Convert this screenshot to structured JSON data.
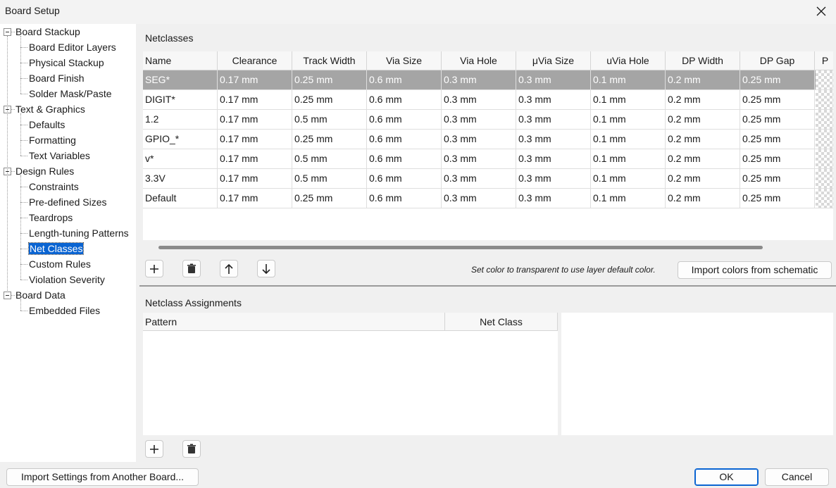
{
  "window": {
    "title": "Board Setup"
  },
  "tree": [
    {
      "label": "Board Stackup",
      "level": 0
    },
    {
      "label": "Board Editor Layers",
      "level": 1
    },
    {
      "label": "Physical Stackup",
      "level": 1
    },
    {
      "label": "Board Finish",
      "level": 1
    },
    {
      "label": "Solder Mask/Paste",
      "level": 1
    },
    {
      "label": "Text & Graphics",
      "level": 0
    },
    {
      "label": "Defaults",
      "level": 1
    },
    {
      "label": "Formatting",
      "level": 1
    },
    {
      "label": "Text Variables",
      "level": 1
    },
    {
      "label": "Design Rules",
      "level": 0
    },
    {
      "label": "Constraints",
      "level": 1
    },
    {
      "label": "Pre-defined Sizes",
      "level": 1
    },
    {
      "label": "Teardrops",
      "level": 1
    },
    {
      "label": "Length-tuning Patterns",
      "level": 1
    },
    {
      "label": "Net Classes",
      "level": 1,
      "selected": true
    },
    {
      "label": "Custom Rules",
      "level": 1
    },
    {
      "label": "Violation Severity",
      "level": 1
    },
    {
      "label": "Board Data",
      "level": 0
    },
    {
      "label": "Embedded Files",
      "level": 1
    }
  ],
  "netclasses": {
    "title": "Netclasses",
    "columns": [
      "Name",
      "Clearance",
      "Track Width",
      "Via Size",
      "Via Hole",
      "μVia Size",
      "uVia Hole",
      "DP Width",
      "DP Gap",
      "P"
    ],
    "rows": [
      [
        "SEG*",
        "0.17 mm",
        "0.25 mm",
        "0.6 mm",
        "0.3 mm",
        "0.3 mm",
        "0.1 mm",
        "0.2 mm",
        "0.25 mm"
      ],
      [
        "DIGIT*",
        "0.17 mm",
        "0.25 mm",
        "0.6 mm",
        "0.3 mm",
        "0.3 mm",
        "0.1 mm",
        "0.2 mm",
        "0.25 mm"
      ],
      [
        "1.2",
        "0.17 mm",
        "0.5 mm",
        "0.6 mm",
        "0.3 mm",
        "0.3 mm",
        "0.1 mm",
        "0.2 mm",
        "0.25 mm"
      ],
      [
        "GPIO_*",
        "0.17 mm",
        "0.25 mm",
        "0.6 mm",
        "0.3 mm",
        "0.3 mm",
        "0.1 mm",
        "0.2 mm",
        "0.25 mm"
      ],
      [
        "v*",
        "0.17 mm",
        "0.5 mm",
        "0.6 mm",
        "0.3 mm",
        "0.3 mm",
        "0.1 mm",
        "0.2 mm",
        "0.25 mm"
      ],
      [
        "3.3V",
        "0.17 mm",
        "0.5 mm",
        "0.6 mm",
        "0.3 mm",
        "0.3 mm",
        "0.1 mm",
        "0.2 mm",
        "0.25 mm"
      ],
      [
        "Default",
        "0.17 mm",
        "0.25 mm",
        "0.6 mm",
        "0.3 mm",
        "0.3 mm",
        "0.1 mm",
        "0.2 mm",
        "0.25 mm"
      ]
    ],
    "hint": "Set color to transparent to use layer default color.",
    "import_colors_label": "Import colors from schematic"
  },
  "assignments": {
    "title": "Netclass Assignments",
    "columns": [
      "Pattern",
      "Net Class"
    ]
  },
  "footer": {
    "import_label": "Import Settings from Another Board...",
    "ok_label": "OK",
    "cancel_label": "Cancel"
  },
  "icons": {
    "close": "close-icon",
    "add": "plus-icon",
    "delete": "trash-icon",
    "up": "arrow-up-icon",
    "down": "arrow-down-icon"
  },
  "colors": {
    "selection": "#0a64d2",
    "row_selected": "#a5a5a5"
  }
}
